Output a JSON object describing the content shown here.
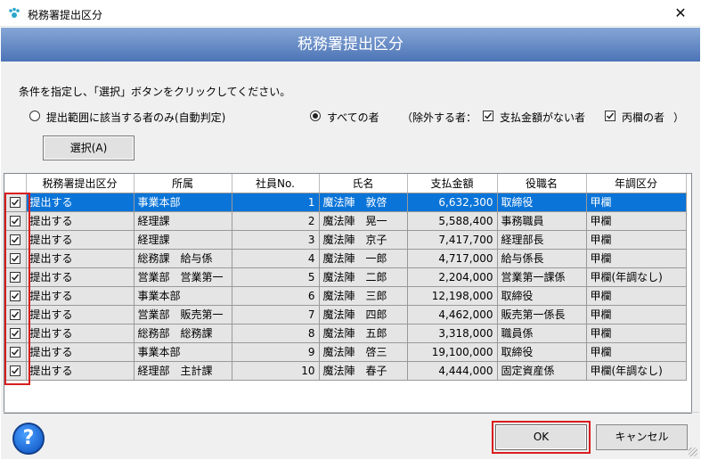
{
  "window": {
    "title": "税務署提出区分",
    "header": "税務署提出区分"
  },
  "instruction": "条件を指定し、「選択」ボタンをクリックしてください。",
  "options": {
    "radio_auto": "提出範囲に該当する者のみ(自動判定)",
    "radio_all": "すべての者",
    "exclude_label": "（除外する者：",
    "exclude_no_payment": "支払金額がない者",
    "exclude_hei": "丙欄の者",
    "exclude_close": "）"
  },
  "select_button": "選択(A)",
  "table": {
    "headers": [
      "税務署提出区分",
      "所属",
      "社員No.",
      "氏名",
      "支払金額",
      "役職名",
      "年調区分"
    ],
    "rows": [
      {
        "checked": true,
        "submit": "提出する",
        "dept": "事業本部",
        "no": "1",
        "name": "魔法陣　敦啓",
        "amount": "6,632,300",
        "title": "取締役",
        "nencho": "甲欄"
      },
      {
        "checked": true,
        "submit": "提出する",
        "dept": "経理課",
        "no": "2",
        "name": "魔法陣　晃一",
        "amount": "5,588,400",
        "title": "事務職員",
        "nencho": "甲欄"
      },
      {
        "checked": true,
        "submit": "提出する",
        "dept": "経理課",
        "no": "3",
        "name": "魔法陣　京子",
        "amount": "7,417,700",
        "title": "経理部長",
        "nencho": "甲欄"
      },
      {
        "checked": true,
        "submit": "提出する",
        "dept": "総務課　給与係",
        "no": "4",
        "name": "魔法陣　一郎",
        "amount": "4,717,000",
        "title": "給与係長",
        "nencho": "甲欄"
      },
      {
        "checked": true,
        "submit": "提出する",
        "dept": "営業部　営業第一",
        "no": "5",
        "name": "魔法陣　二郎",
        "amount": "2,204,000",
        "title": "営業第一課係",
        "nencho": "甲欄(年調なし)"
      },
      {
        "checked": true,
        "submit": "提出する",
        "dept": "事業本部",
        "no": "6",
        "name": "魔法陣　三郎",
        "amount": "12,198,000",
        "title": "取締役",
        "nencho": "甲欄"
      },
      {
        "checked": true,
        "submit": "提出する",
        "dept": "営業部　販売第一",
        "no": "7",
        "name": "魔法陣　四郎",
        "amount": "4,462,000",
        "title": "販売第一係長",
        "nencho": "甲欄"
      },
      {
        "checked": true,
        "submit": "提出する",
        "dept": "総務部　総務課",
        "no": "8",
        "name": "魔法陣　五郎",
        "amount": "3,318,000",
        "title": "職員係",
        "nencho": "甲欄"
      },
      {
        "checked": true,
        "submit": "提出する",
        "dept": "事業本部",
        "no": "9",
        "name": "魔法陣　啓三",
        "amount": "19,100,000",
        "title": "取締役",
        "nencho": "甲欄"
      },
      {
        "checked": true,
        "submit": "提出する",
        "dept": "経理部　主計課",
        "no": "10",
        "name": "魔法陣　春子",
        "amount": "4,444,000",
        "title": "固定資産係",
        "nencho": "甲欄(年調なし)"
      }
    ]
  },
  "help_button": "?",
  "ok_button": "OK",
  "cancel_button": "キャンセル",
  "colors": {
    "header_top": "#86a6d6",
    "header_bottom": "#4c74b6",
    "selected_row": "#0a74d8",
    "highlight": "#d81e1e"
  }
}
